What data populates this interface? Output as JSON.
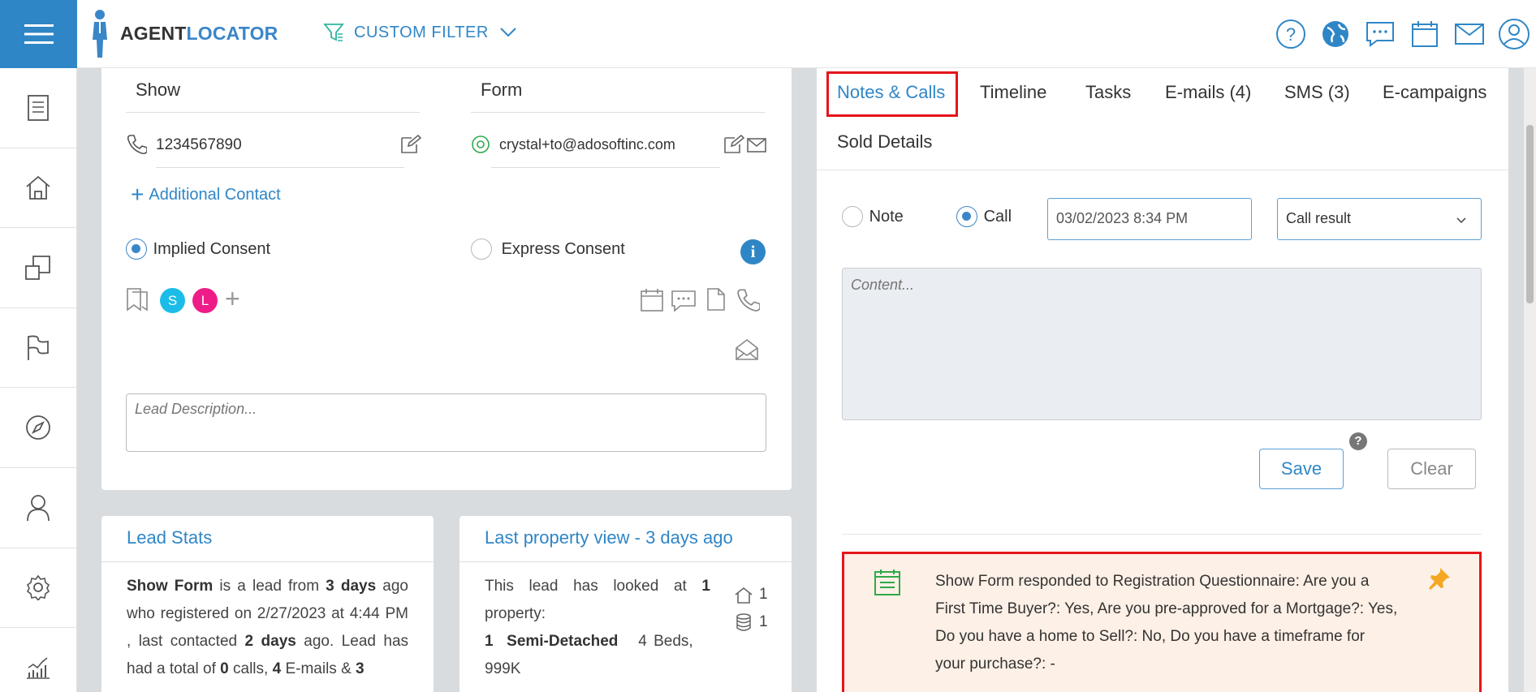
{
  "header": {
    "logo_part1": "AGENT",
    "logo_part2": "LOCATOR",
    "filter_label": "CUSTOM FILTER",
    "icons": [
      "help-icon",
      "globe-icon",
      "chat-icon",
      "calendar-icon",
      "mail-icon",
      "user-icon"
    ]
  },
  "sidebar": {
    "icons": [
      "document-icon",
      "home-icon",
      "windows-icon",
      "flag-icon",
      "compass-icon",
      "person-icon",
      "gear-icon",
      "chart-icon"
    ]
  },
  "contact": {
    "first_name": "Show",
    "last_name": "Form",
    "phone": "1234567890",
    "email": "crystal+to@adosoftinc.com",
    "additional_contact": "Additional Contact",
    "implied_consent": "Implied Consent",
    "express_consent": "Express Consent",
    "avatar_s": "S",
    "avatar_l": "L",
    "avatar_s_color": "#1bbde8",
    "avatar_l_color": "#ee1c88",
    "description_placeholder": "Lead Description..."
  },
  "lead_stats": {
    "title": "Lead Stats",
    "name": "Show Form",
    "t1": " is a lead from ",
    "days": "3 days",
    "t2": " ago who registered on 2/27/2023 at 4:44 PM , last contacted ",
    "last_contacted": "2 days",
    "t3": " ago. Lead has had a total of ",
    "calls": "0",
    "t4": " calls, ",
    "emails": "4",
    "t5": " E-mails & ",
    "sms": "3"
  },
  "property_view": {
    "title": "Last property view - 3 days ago",
    "t1": "This lead has looked at ",
    "count": "1",
    "t2": " property:",
    "line_count": "1",
    "line_type": "Semi-Detached",
    "line_beds": "4 Beds,",
    "line_price": "999K",
    "home_count": "1",
    "db_count": "1"
  },
  "tabs": {
    "notes_calls": "Notes & Calls",
    "timeline": "Timeline",
    "tasks": "Tasks",
    "emails": "E-mails (4)",
    "sms": "SMS (3)",
    "ecampaigns": "E-campaigns",
    "sold_details": "Sold Details"
  },
  "note_form": {
    "note_label": "Note",
    "call_label": "Call",
    "datetime": "03/02/2023 8:34 PM",
    "call_result": "Call result",
    "content_placeholder": "Content...",
    "save": "Save",
    "clear": "Clear"
  },
  "pinned_note": {
    "text": "Show Form responded to Registration Questionnaire: Are you a First Time Buyer?: Yes, Are you pre-approved for a Mortgage?: Yes, Do you have a home to Sell?: No, Do you have a timeframe for your purchase?: -"
  },
  "colors": {
    "accent": "#2f86c6",
    "highlight": "#e6141b",
    "note_bg": "#fdf0e6",
    "pin": "#f5a623",
    "note_icon": "#2eaa4a"
  }
}
